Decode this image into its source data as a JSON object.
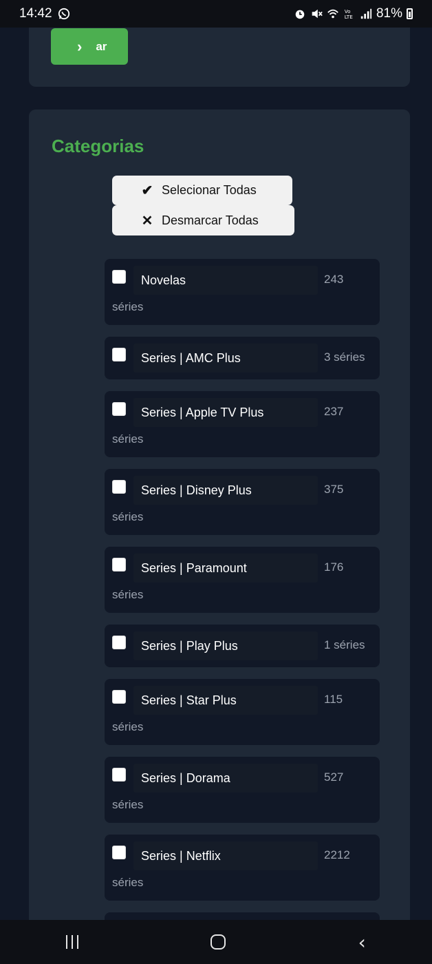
{
  "status_bar": {
    "time": "14:42",
    "battery": "81%",
    "icons": [
      "whatsapp-icon",
      "alarm-icon",
      "mute-icon",
      "wifi-icon",
      "volte-icon",
      "signal-icon",
      "battery-icon"
    ]
  },
  "top_button": {
    "label": "ar",
    "icon": "chevron-right-icon"
  },
  "categories": {
    "title": "Categorias",
    "select_all": "Selecionar Todas",
    "deselect_all": "Desmarcar Todas",
    "items": [
      {
        "name": "Novelas",
        "count_line1": "243",
        "count_line2": "séries"
      },
      {
        "name": "Series | AMC Plus",
        "count_line1": "3 séries",
        "count_line2": ""
      },
      {
        "name": "Series | Apple TV Plus",
        "count_line1": "237",
        "count_line2": "séries"
      },
      {
        "name": "Series | Disney Plus",
        "count_line1": "375",
        "count_line2": "séries"
      },
      {
        "name": "Series | Paramount",
        "count_line1": "176",
        "count_line2": "séries"
      },
      {
        "name": "Series | Play Plus",
        "count_line1": "1 séries",
        "count_line2": ""
      },
      {
        "name": "Series | Star Plus",
        "count_line1": "115",
        "count_line2": "séries"
      },
      {
        "name": "Series | Dorama",
        "count_line1": "527",
        "count_line2": "séries"
      },
      {
        "name": "Series | Netflix",
        "count_line1": "2212",
        "count_line2": "séries"
      }
    ]
  },
  "colors": {
    "accent_green": "#4caf50",
    "background": "#111827",
    "card": "#1f2937"
  }
}
